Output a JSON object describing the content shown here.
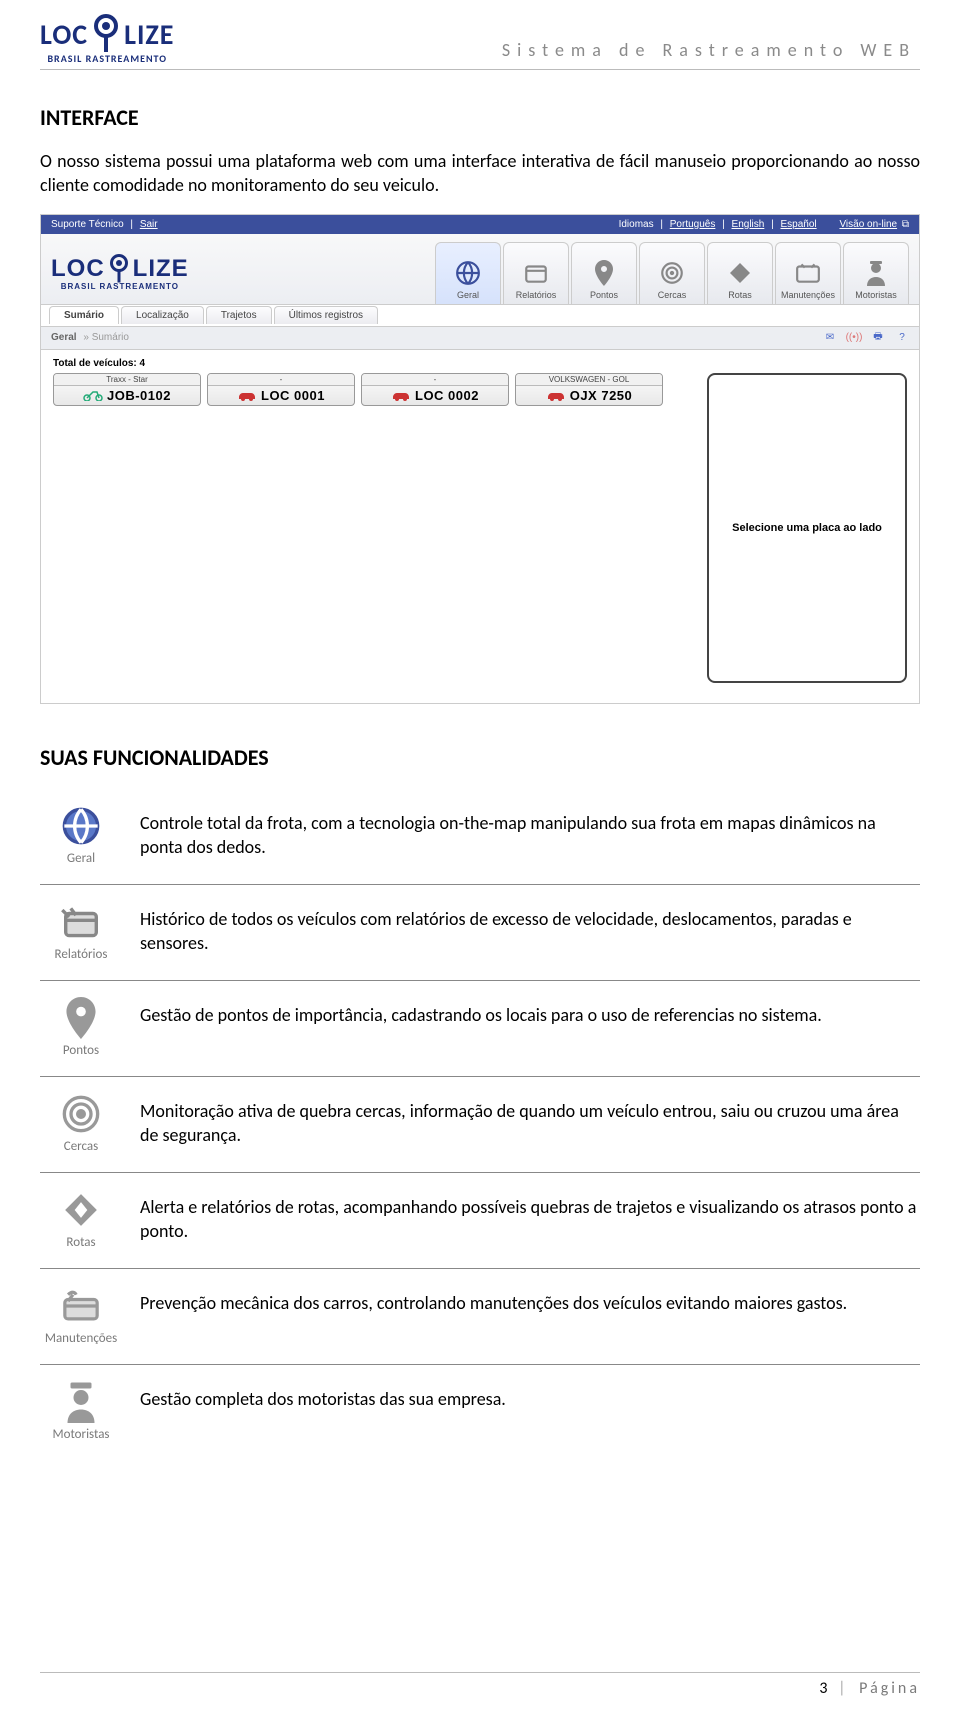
{
  "header": {
    "logo_text_left": "LOC",
    "logo_text_right": "LIZE",
    "logo_sub": "BRASIL RASTREAMENTO",
    "title": "Sistema de Rastreamento WEB"
  },
  "section1": {
    "heading": "INTERFACE",
    "paragraph": "O nosso sistema possui uma plataforma web com uma interface interativa de fácil manuseio proporcionando ao nosso cliente comodidade no monitoramento do seu veiculo."
  },
  "app": {
    "topbar": {
      "left_support": "Suporte Técnico",
      "left_exit": "Sair",
      "right_idiomas": "Idiomas",
      "langs": [
        "Português",
        "English",
        "Español"
      ],
      "right_online": "Visão on-line"
    },
    "logo": {
      "left": "LOC",
      "right": "LIZE",
      "sub": "BRASIL RASTREAMENTO"
    },
    "nav": [
      {
        "label": "Geral"
      },
      {
        "label": "Relatórios"
      },
      {
        "label": "Pontos"
      },
      {
        "label": "Cercas"
      },
      {
        "label": "Rotas"
      },
      {
        "label": "Manutenções"
      },
      {
        "label": "Motoristas"
      }
    ],
    "subtabs": [
      "Sumário",
      "Localização",
      "Trajetos",
      "Últimos registros"
    ],
    "breadcrumb_left": "Geral",
    "breadcrumb_right": "» Sumário",
    "total_label": "Total de veículos: 4",
    "plates": [
      {
        "top": "Traxx - Star",
        "label": "JOB-0102",
        "type": "moto"
      },
      {
        "top": "-",
        "label": "LOC 0001",
        "type": "car"
      },
      {
        "top": "-",
        "label": "LOC 0002",
        "type": "car"
      },
      {
        "top": "VOLKSWAGEN - GOL",
        "label": "OJX 7250",
        "type": "car"
      }
    ],
    "side_msg": "Selecione uma placa ao lado"
  },
  "section2": {
    "heading": "SUAS FUNCIONALIDADES"
  },
  "features": [
    {
      "icon": "globe",
      "label": "Geral",
      "text": "Controle total da frota, com a tecnologia on-the-map manipulando sua frota em mapas dinâmicos na ponta dos dedos."
    },
    {
      "icon": "report",
      "label": "Relatórios",
      "text": "Histórico de todos os veículos com relatórios de excesso de velocidade, deslocamentos, paradas e sensores."
    },
    {
      "icon": "pin",
      "label": "Pontos",
      "text": "Gestão de pontos de importância, cadastrando os locais para o uso de referencias no sistema."
    },
    {
      "icon": "target",
      "label": "Cercas",
      "text": "Monitoração ativa de quebra cercas, informação de quando um veículo entrou, saiu ou cruzou uma área de segurança."
    },
    {
      "icon": "diamond",
      "label": "Rotas",
      "text": "Alerta e relatórios de rotas, acompanhando possíveis quebras de trajetos e visualizando os atrasos ponto a ponto."
    },
    {
      "icon": "wrench",
      "label": "Manutenções",
      "text": "Prevenção mecânica dos carros, controlando manutenções dos veículos evitando maiores gastos."
    },
    {
      "icon": "driver",
      "label": "Motoristas",
      "text": "Gestão  completa dos motoristas das sua empresa."
    }
  ],
  "footer": {
    "page_number": "3",
    "page_label": "Página"
  }
}
